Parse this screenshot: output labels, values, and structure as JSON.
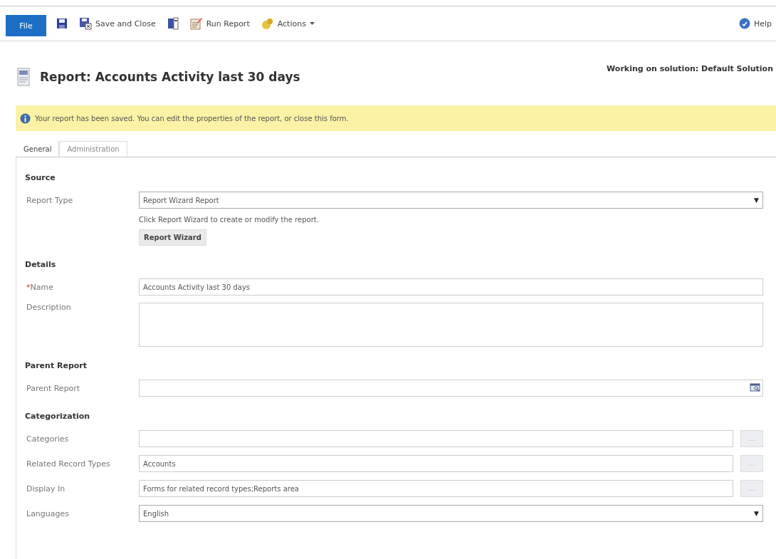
{
  "toolbar": {
    "file": "File",
    "items": [
      {
        "kind": "save"
      },
      {
        "kind": "save-close",
        "label": "Save and Close"
      },
      {
        "kind": "page"
      },
      {
        "kind": "run",
        "label": "Run Report"
      },
      {
        "kind": "actions",
        "label": "Actions",
        "dropdown": true
      }
    ],
    "help": "Help"
  },
  "header": {
    "title": "Report: Accounts Activity last 30 days",
    "solution": "Working on solution: Default Solution"
  },
  "notification": "Your report has been saved. You can edit the properties of the report, or close this form.",
  "tabs": [
    {
      "label": "General",
      "selected": true
    },
    {
      "label": "Administration",
      "selected": false
    }
  ],
  "sections": [
    {
      "title": "Source",
      "fields": [
        {
          "kind": "select",
          "label": "Report Type",
          "value": "Report Wizard Report",
          "arrow": "▼",
          "note": "Click Report Wizard to create or modify the report.",
          "button": "Report Wizard"
        }
      ]
    },
    {
      "title": "Details",
      "fields": [
        {
          "kind": "text",
          "label": "Name",
          "required_mark": "*",
          "value": "Accounts Activity last 30 days"
        },
        {
          "kind": "textarea",
          "label": "Description"
        }
      ]
    },
    {
      "title": "Parent Report",
      "fields": [
        {
          "kind": "lookup",
          "label": "Parent Report"
        }
      ]
    },
    {
      "title": "Categorization",
      "fields": [
        {
          "kind": "multi",
          "label": "Categories",
          "button": "..."
        },
        {
          "kind": "multi",
          "label": "Related Record Types",
          "value": "Accounts",
          "button": "..."
        },
        {
          "kind": "multi",
          "label": "Display In",
          "value": "Forms for related record types;Reports area",
          "button": "..."
        },
        {
          "kind": "select",
          "label": "Languages",
          "value": "English",
          "arrow": "▼"
        }
      ]
    }
  ]
}
